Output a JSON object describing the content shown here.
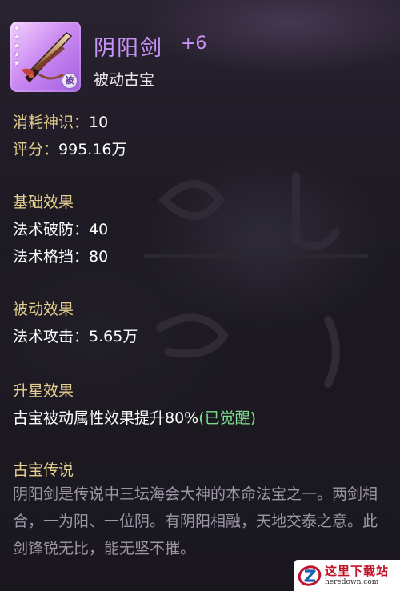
{
  "item": {
    "name": "阴阳剑",
    "plus": "+6",
    "type": "被动古宝",
    "stars": 5,
    "badge": "被",
    "accent_color": "#c892f6"
  },
  "stats": {
    "consume_label": "消耗神识：",
    "consume_value": "10",
    "score_label": "评分：",
    "score_value": "995.16万"
  },
  "basic": {
    "title": "基础效果",
    "lines": [
      {
        "label": "法术破防：",
        "value": "40"
      },
      {
        "label": "法术格挡：",
        "value": "80"
      }
    ]
  },
  "passive": {
    "title": "被动效果",
    "lines": [
      {
        "label": "法术攻击：",
        "value": "5.65万"
      }
    ]
  },
  "star_up": {
    "title": "升星效果",
    "text": "古宝被动属性效果提升80%",
    "status": "(已觉醒)"
  },
  "lore": {
    "title": "古宝传说",
    "text": "阴阳剑是传说中三坛海会大神的本命法宝之一。两剑相合，一为阳、一位阴。有阴阳相融，天地交泰之意。此剑锋锐无比，能无坚不摧。"
  },
  "watermark": {
    "cn": "这里下载站",
    "en": "heredown.com"
  },
  "colors": {
    "section_title": "#e3cf8e",
    "awakened": "#7ee08f",
    "lore_text": "#9c96a6"
  }
}
